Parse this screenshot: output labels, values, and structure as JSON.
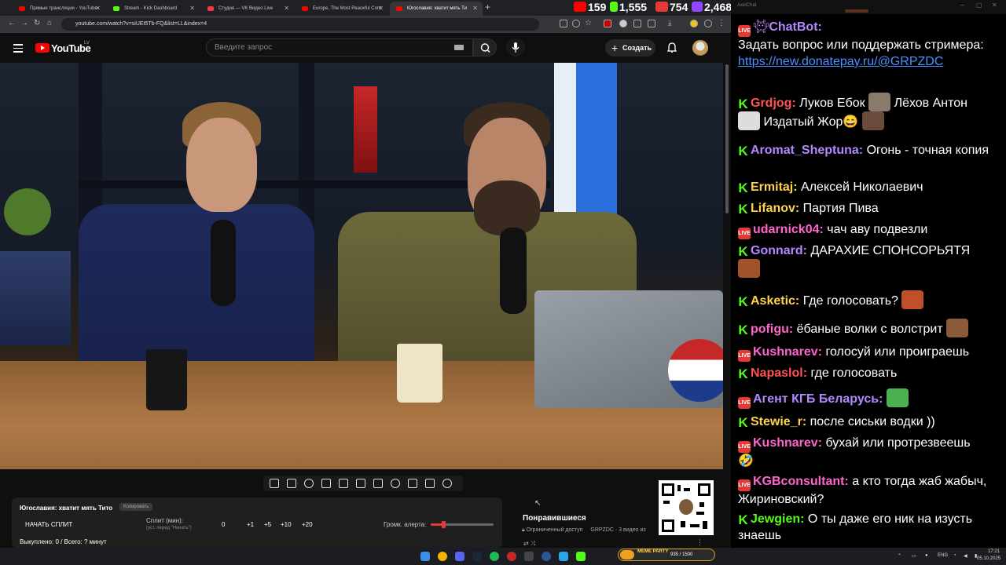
{
  "browser": {
    "tabs": [
      {
        "label": "Прямые трансляции - YouTube",
        "icon": "youtube-icon",
        "color": "#ff0000"
      },
      {
        "label": "Stream - Kick Dashboard",
        "icon": "kick-icon",
        "color": "#53fc18"
      },
      {
        "label": "Студия — VK Видео Live",
        "icon": "vk-icon",
        "color": "#ff3347"
      },
      {
        "label": "Europe, The Most Peaceful Cont",
        "icon": "youtube-icon",
        "color": "#ff0000"
      },
      {
        "label": "Югославия: хватит мять Ти",
        "icon": "youtube-icon",
        "color": "#ff0000"
      }
    ],
    "url": "youtube.com/watch?v=siUEt5Tb-FQ&list=LL&index=4"
  },
  "viewer_counts": {
    "youtube": "159",
    "kick": "1,555",
    "vk": "754",
    "total": "2,468",
    "colors": {
      "youtube": "#ff0000",
      "kick": "#53fc18",
      "vk": "#e53935",
      "total": "#9146ff"
    }
  },
  "youtube": {
    "logo_text": "YouTube",
    "region": "LV",
    "search_placeholder": "Введите запрос",
    "create_label": "Создать"
  },
  "split_panel": {
    "title": "Югославия: хватит мять Тито",
    "copy_button": "Копировать",
    "start_split": "НАЧАТЬ СПЛИТ",
    "split_label": "Сплит (мин):",
    "split_hint": "(уст. перед \"Начать\")",
    "split_value": "0",
    "increments": [
      "+1",
      "+5",
      "+10",
      "+20"
    ],
    "alert_volume_label": "Громк. алерта:",
    "alert_volume_fraction": 0.2,
    "bought": "Выкуплено: 0 / Всего: ? минут"
  },
  "liked": {
    "title": "Понравившиеся",
    "access": "Ограниченный доступ",
    "channel": "GRPZDC · 3 видео из"
  },
  "meme_party": {
    "label": "MEME PARTY",
    "progress": "935 / 1500"
  },
  "tray": {
    "lang": "ENG",
    "time": "17:21",
    "date": "05.10.2025"
  },
  "chat": {
    "window_title": "AxelChat",
    "messages": [
      {
        "platform": "live",
        "user": "ChatBot:",
        "color": "#b388ff",
        "text": "Задать вопрос или поддержать стримера:",
        "link": "https://new.donatepay.ru/@GRPZDC"
      },
      {
        "platform": "kick",
        "user": "Grdjog:",
        "color": "#ff5252",
        "text": "Луков Ебок",
        "text2": "Лёхов Антон",
        "text3": "Издатый Жор"
      },
      {
        "platform": "kick",
        "user": "Aromat_Sheptuna:",
        "color": "#b388ff",
        "text": "Огонь - точная копия"
      },
      {
        "platform": "kick",
        "user": "Ermitaj:",
        "color": "#ffd34d",
        "text": "Алексей Николаевич"
      },
      {
        "platform": "kick",
        "user": "Lifanov:",
        "color": "#ffd34d",
        "text": "Партия Пива"
      },
      {
        "platform": "live",
        "user": "udarnick04:",
        "color": "#ff66cc",
        "text": "чач аву подвезли"
      },
      {
        "platform": "kick",
        "user": "Gonnard:",
        "color": "#b388ff",
        "text": "ДАРАХИЕ СПОНСОРЬЯТЯ"
      },
      {
        "platform": "kick",
        "user": "Asketic:",
        "color": "#ffd34d",
        "text": "Где голосовать?"
      },
      {
        "platform": "kick",
        "user": "pofigu:",
        "color": "#ff66cc",
        "text": "ёбаные волки с волстрит"
      },
      {
        "platform": "live",
        "user": "Kushnarev:",
        "color": "#ff66cc",
        "text": "голосуй или проиграешь"
      },
      {
        "platform": "kick",
        "user": "Napaslol:",
        "color": "#ff5252",
        "text": "где голосовать"
      },
      {
        "platform": "live",
        "user": "Агент КГБ Беларусь:",
        "color": "#b388ff",
        "text": ""
      },
      {
        "platform": "kick",
        "user": "Stewie_r:",
        "color": "#ffd34d",
        "text": "после сиськи водки ))"
      },
      {
        "platform": "live",
        "user": "Kushnarev:",
        "color": "#ff66cc",
        "text": "бухай или протрезвеешь"
      },
      {
        "platform": "live",
        "user": "KGBconsultant:",
        "color": "#ff66cc",
        "text": "а кто тогда жаб жабыч, Жириновский?"
      },
      {
        "platform": "kick",
        "user": "Jewgien:",
        "color": "#53fc18",
        "text": "О ты даже его ник на изусть знаешь"
      }
    ]
  }
}
